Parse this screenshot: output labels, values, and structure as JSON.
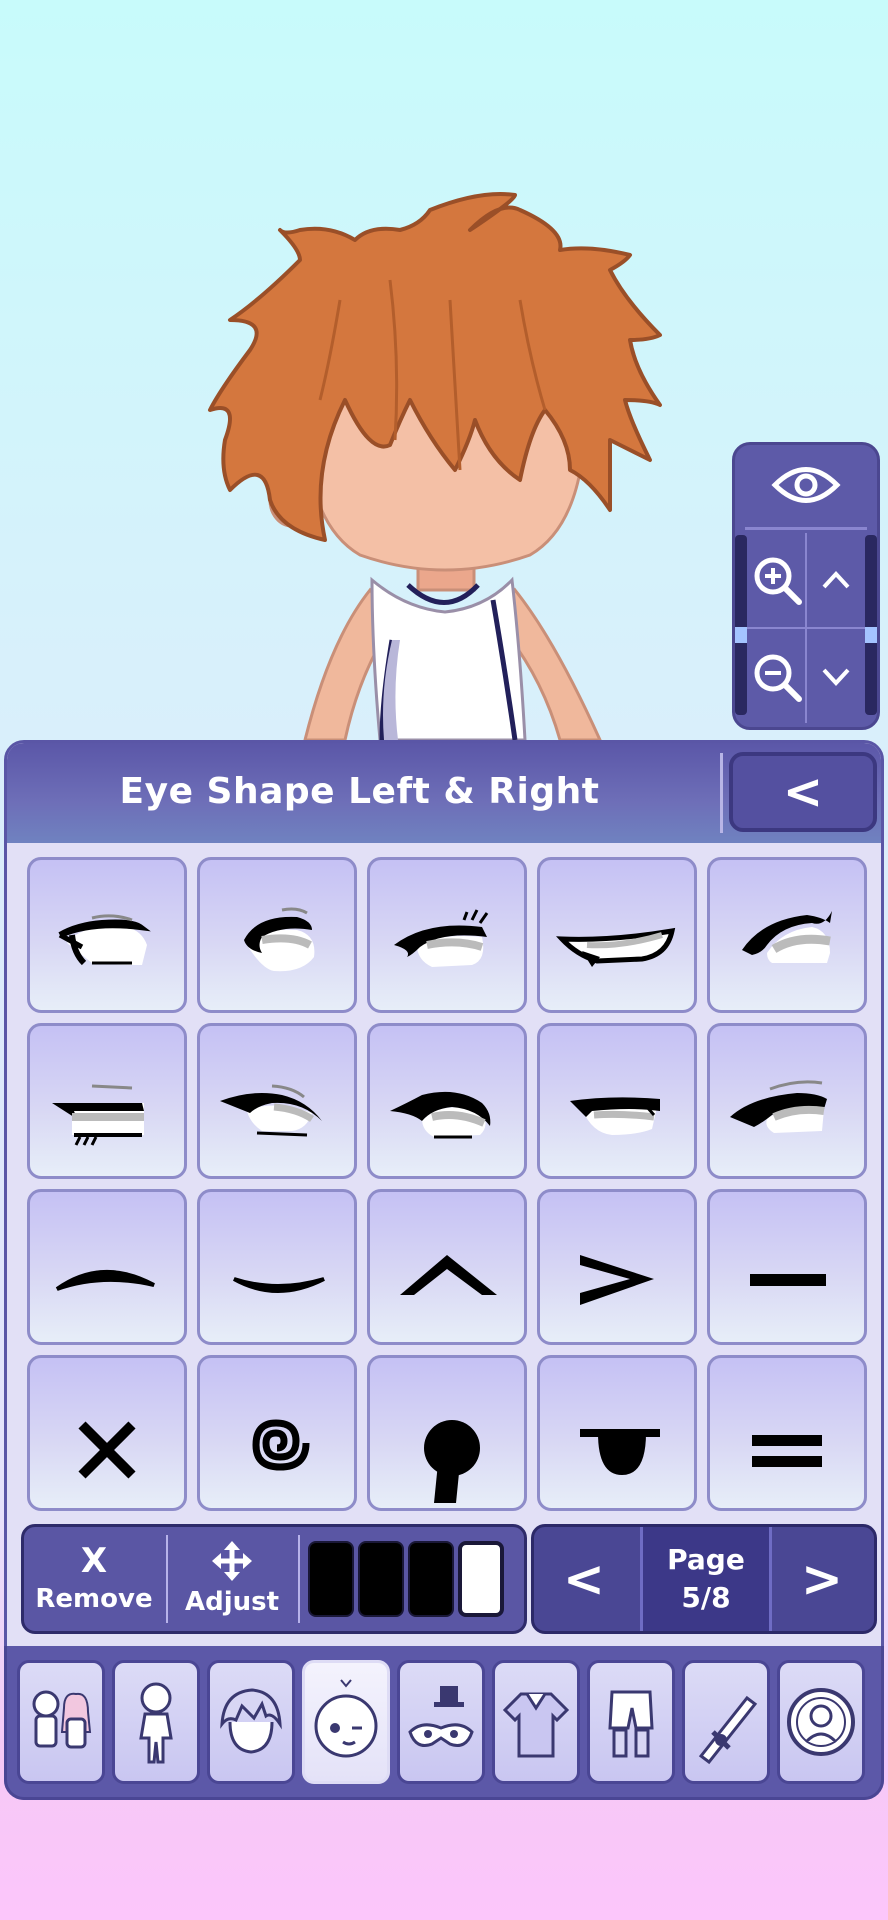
{
  "panel": {
    "title": "Eye Shape Left & Right",
    "back_label": "<"
  },
  "grid": {
    "cells": [
      {
        "icon": "eye-shape-1-icon"
      },
      {
        "icon": "eye-shape-2-icon"
      },
      {
        "icon": "eye-shape-3-icon"
      },
      {
        "icon": "eye-shape-4-icon"
      },
      {
        "icon": "eye-shape-5-icon"
      },
      {
        "icon": "eye-shape-6-icon"
      },
      {
        "icon": "eye-shape-7-icon"
      },
      {
        "icon": "eye-shape-8-icon"
      },
      {
        "icon": "eye-shape-9-icon"
      },
      {
        "icon": "eye-shape-10-icon"
      },
      {
        "icon": "closed-eye-up-arc-icon"
      },
      {
        "icon": "closed-eye-down-arc-icon"
      },
      {
        "icon": "caret-up-eye-icon"
      },
      {
        "icon": "greater-than-eye-icon"
      },
      {
        "icon": "dash-eye-icon"
      },
      {
        "icon": "x-eye-icon"
      },
      {
        "icon": "spiral-eye-icon"
      },
      {
        "icon": "keyhole-eye-icon"
      },
      {
        "icon": "tongue-eye-icon"
      },
      {
        "icon": "equals-eye-icon"
      }
    ]
  },
  "toolbar": {
    "remove_icon": "X",
    "remove_label": "Remove",
    "adjust_label": "Adjust",
    "swatches": [
      "#000000",
      "#000000",
      "#000000",
      "#ffffff"
    ]
  },
  "pager": {
    "prev_label": "<",
    "next_label": ">",
    "page_label": "Page",
    "page_value": "5/8"
  },
  "categories": [
    {
      "icon": "presets-characters-icon",
      "active": false
    },
    {
      "icon": "body-icon",
      "active": false
    },
    {
      "icon": "hair-icon",
      "active": false
    },
    {
      "icon": "face-icon",
      "active": true
    },
    {
      "icon": "accessories-hat-mask-icon",
      "active": false
    },
    {
      "icon": "shirt-icon",
      "active": false
    },
    {
      "icon": "pants-icon",
      "active": false
    },
    {
      "icon": "weapon-props-icon",
      "active": false
    },
    {
      "icon": "profile-portrait-icon",
      "active": false
    }
  ],
  "colors": {
    "accent": "#5a56a6",
    "hair": "#d4773e",
    "skin": "#f2bba0"
  }
}
